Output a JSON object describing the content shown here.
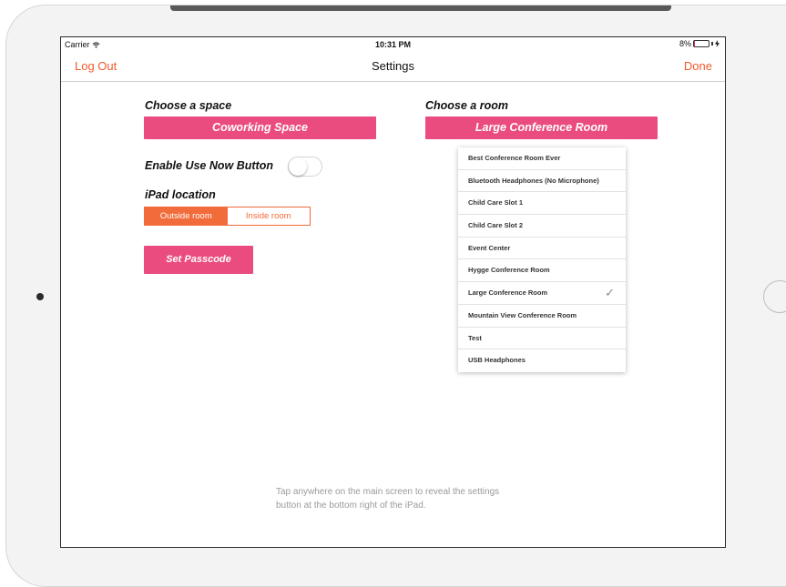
{
  "status_bar": {
    "carrier": "Carrier",
    "time": "10:31 PM",
    "battery": "8%",
    "battery_level": 0.08
  },
  "nav": {
    "left": "Log Out",
    "title": "Settings",
    "right": "Done"
  },
  "space": {
    "label": "Choose a space",
    "value": "Coworking Space"
  },
  "room": {
    "label": "Choose a room",
    "value": "Large Conference Room",
    "options": [
      "Best Conference Room Ever",
      "Bluetooth Headphones (No Microphone)",
      "Child Care Slot 1",
      "Child Care Slot 2",
      "Event Center",
      "Hygge Conference Room",
      "Large Conference Room",
      "Mountain View Conference Room",
      "Test",
      "USB Headphones"
    ],
    "check": "✓"
  },
  "use_now": {
    "label": "Enable Use Now Button",
    "enabled": false
  },
  "location": {
    "label": "iPad location",
    "options": [
      "Outside room",
      "Inside room"
    ],
    "selected": "Outside room"
  },
  "passcode": {
    "label": "Set Passcode"
  },
  "hint": {
    "line1": "Tap anywhere on the main screen to reveal the settings",
    "line2": "button at the bottom right of the iPad."
  },
  "colors": {
    "accent_orange": "#f05a2c",
    "pink": "#ea4c7f",
    "segment_orange": "#f26b3a"
  },
  "icons": {
    "wifi": "wifi-icon",
    "battery": "battery-icon",
    "checkmark": "checkmark-icon"
  }
}
